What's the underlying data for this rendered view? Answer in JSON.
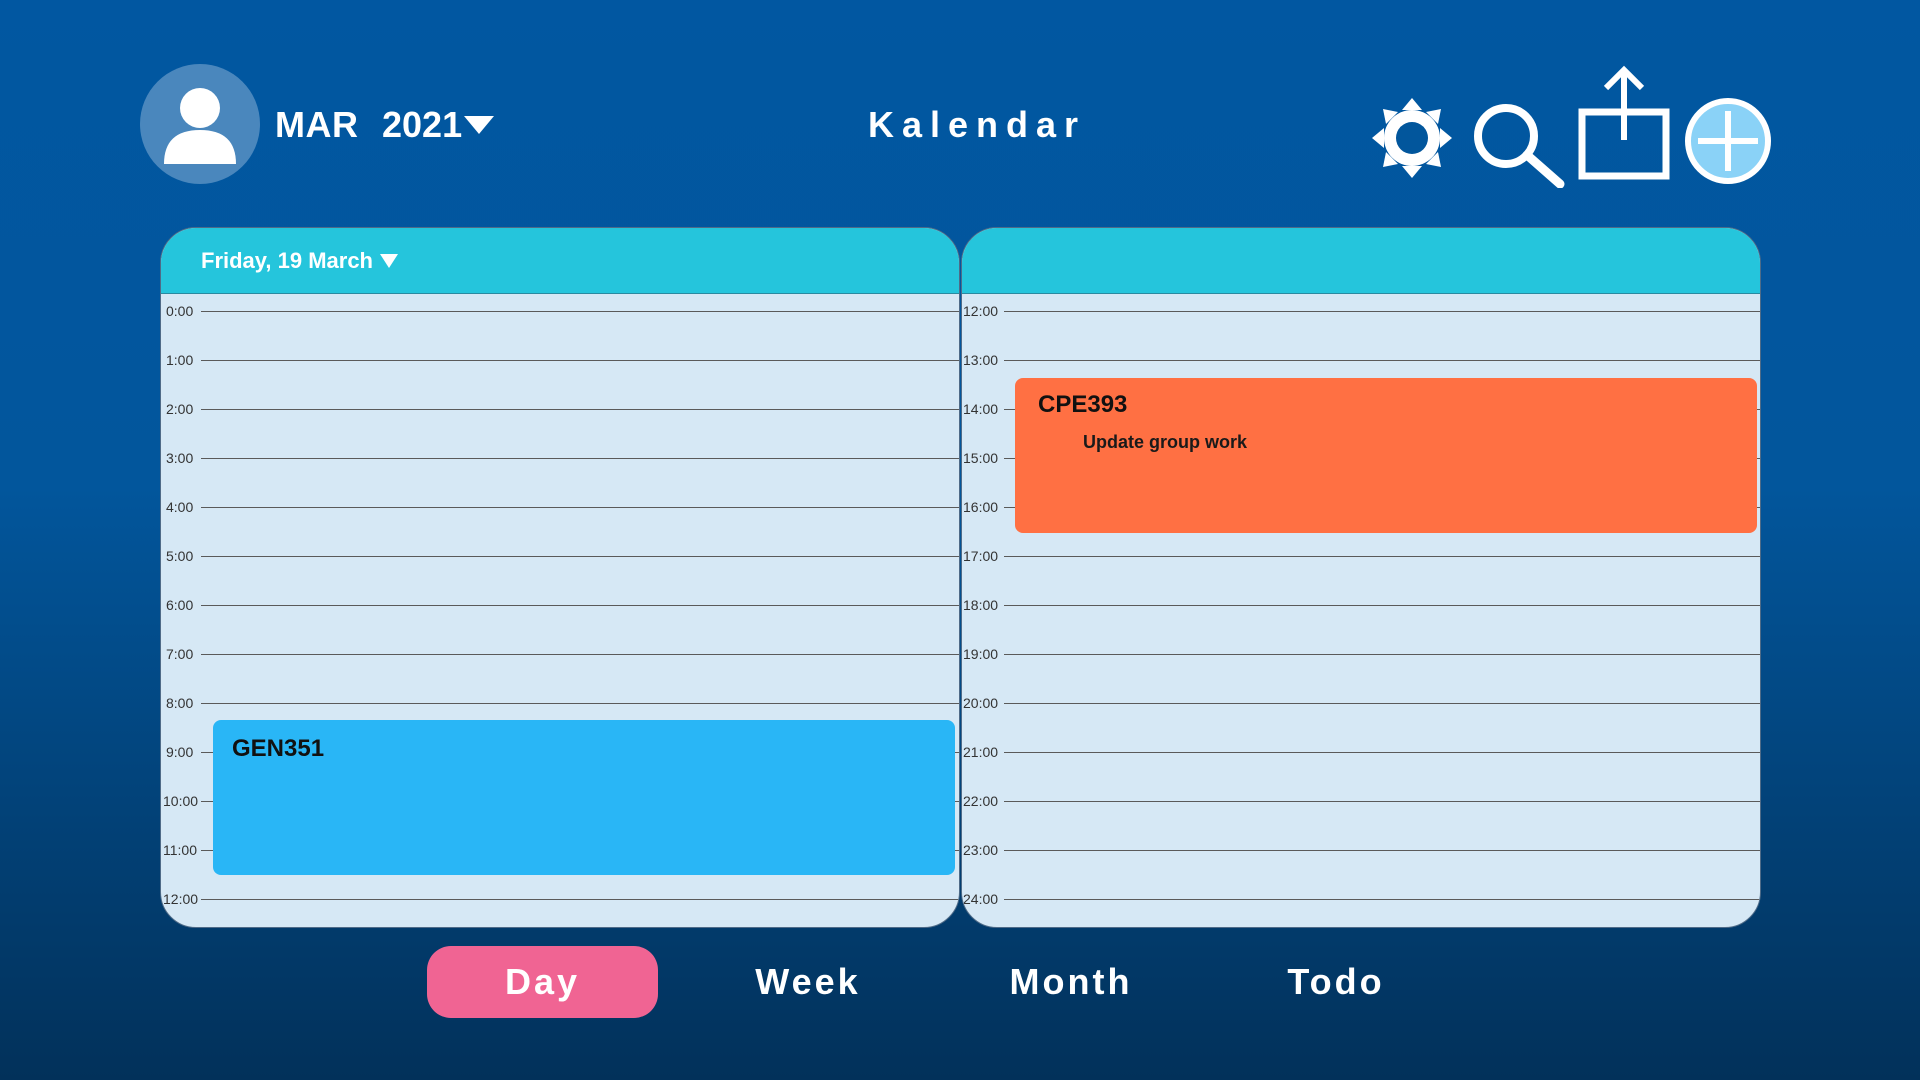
{
  "header": {
    "month": "MAR",
    "year": "2021",
    "app_title": "Kalendar",
    "icons": [
      "avatar-icon",
      "settings-icon",
      "search-icon",
      "share-icon",
      "add-icon"
    ]
  },
  "day_panel": {
    "date_label": "Friday, 19 March",
    "hours_left": [
      "0:00",
      "1:00",
      "2:00",
      "3:00",
      "4:00",
      "5:00",
      "6:00",
      "7:00",
      "8:00",
      "9:00",
      "10:00",
      "11:00",
      "12:00"
    ],
    "hours_right": [
      "12:00",
      "13:00",
      "14:00",
      "15:00",
      "16:00",
      "17:00",
      "18:00",
      "19:00",
      "20:00",
      "21:00",
      "22:00",
      "23:00",
      "24:00"
    ]
  },
  "events": [
    {
      "title": "GEN351",
      "note": "",
      "color": "#29b6f6"
    },
    {
      "title": "CPE393",
      "note": "Update group work",
      "color": "#ff7043"
    }
  ],
  "tabs": [
    {
      "label": "Day",
      "active": true
    },
    {
      "label": "Week",
      "active": false
    },
    {
      "label": "Month",
      "active": false
    },
    {
      "label": "Todo",
      "active": false
    }
  ],
  "colors": {
    "background_top": "#0157a1",
    "background_bottom": "#02315a",
    "panel_header": "#25c5dc",
    "panel_body": "#d6e8f5",
    "active_tab": "#f06493"
  }
}
